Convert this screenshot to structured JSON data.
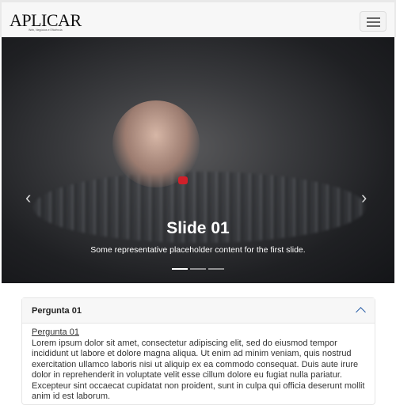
{
  "navbar": {
    "brand": "APLICAR",
    "brand_tagline": "Web, Negócios e Eficiência",
    "menu_icon": "hamburger-icon"
  },
  "carousel": {
    "slides": [
      {
        "title": "Slide 01",
        "text": "Some representative placeholder content for the first slide."
      }
    ],
    "prev_icon": "chevron-left-icon",
    "next_icon": "chevron-right-icon",
    "prev": "‹",
    "next": "›",
    "active_index": 0,
    "indicator_count": 3
  },
  "accordion": {
    "items": [
      {
        "header": "Pergunta 01",
        "expanded": true,
        "subtitle": "Pergunta 01",
        "text": "Lorem ipsum dolor sit amet, consectetur adipiscing elit, sed do eiusmod tempor incididunt ut labore et dolore magna aliqua. Ut enim ad minim veniam, quis nostrud exercitation ullamco laboris nisi ut aliquip ex ea commodo consequat. Duis aute irure dolor in reprehenderit in voluptate velit esse cillum dolore eu fugiat nulla pariatur. Excepteur sint occaecat cupidatat non proident, sunt in culpa qui officia deserunt mollit anim id est laborum."
      }
    ]
  },
  "colors": {
    "accent": "#2b5fa8"
  }
}
